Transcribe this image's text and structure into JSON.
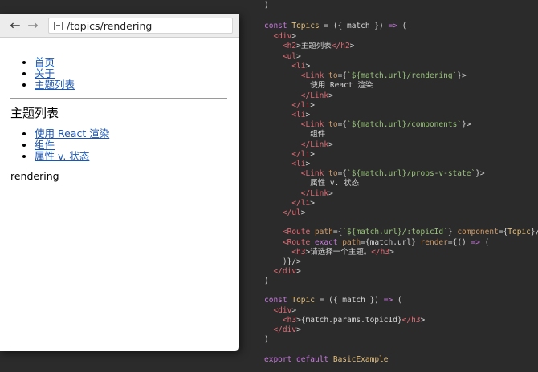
{
  "browser": {
    "back_icon": "arrow-left-icon",
    "forward_icon": "arrow-right-icon",
    "page_icon": "page-icon",
    "url": "/topics/rendering"
  },
  "page": {
    "nav": [
      "首页",
      "关于",
      "主题列表"
    ],
    "topics_title": "主题列表",
    "topics": [
      "使用 React 渲染",
      "组件",
      "属性 v. 状态"
    ],
    "topic_id": "rendering"
  },
  "code": {
    "lines": [
      ")",
      "const Topics = ({ match }) => (",
      "  <div>",
      "    <h2>主题列表</h2>",
      "    <ul>",
      "      <li>",
      "        <Link to={`${match.url}/rendering`}>",
      "          使用 React 渲染",
      "        </Link>",
      "      </li>",
      "      <li>",
      "        <Link to={`${match.url}/components`}>",
      "          组件",
      "        </Link>",
      "      </li>",
      "      <li>",
      "        <Link to={`${match.url}/props-v-state`}>",
      "          属性 v. 状态",
      "        </Link>",
      "      </li>",
      "    </ul>",
      "",
      "    <Route path={`${match.url}/:topicId`} component={Topic}/>",
      "    <Route exact path={match.url} render={() => (",
      "      <h3>请选择一个主题。</h3>",
      "    )}/>",
      "  </div>",
      ")",
      "",
      "const Topic = ({ match }) => (",
      "  <div>",
      "    <h3>{match.params.topicId}</h3>",
      "  </div>",
      ")",
      "",
      "export default BasicExample"
    ],
    "colors": {
      "keyword": "#c678dd",
      "identifier": "#e6c07b",
      "tag": "#e06c75",
      "string": "#98c379",
      "background": "#2b2b2b"
    }
  }
}
